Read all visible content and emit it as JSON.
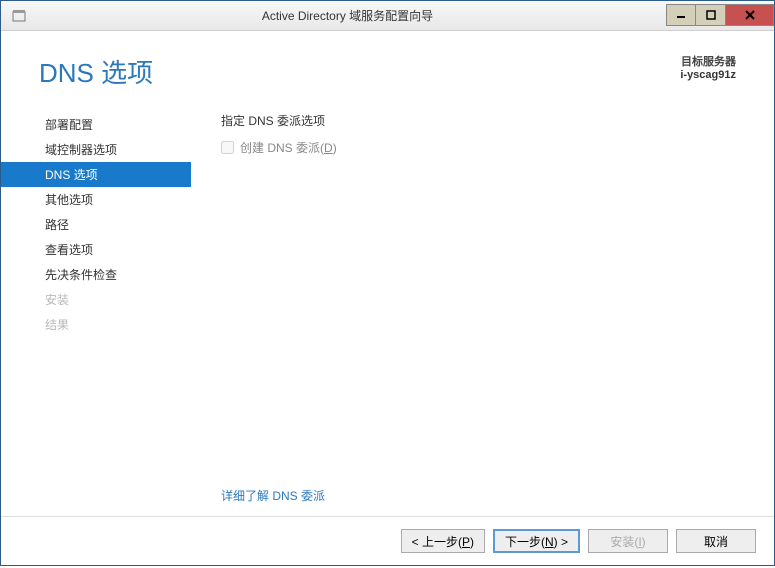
{
  "titlebar": {
    "title": "Active Directory 域服务配置向导"
  },
  "header": {
    "page_title": "DNS 选项",
    "target_label": "目标服务器",
    "target_name": "i-yscag91z"
  },
  "sidebar": {
    "items": [
      {
        "label": "部署配置",
        "state": "normal"
      },
      {
        "label": "域控制器选项",
        "state": "normal"
      },
      {
        "label": "DNS 选项",
        "state": "selected"
      },
      {
        "label": "其他选项",
        "state": "normal"
      },
      {
        "label": "路径",
        "state": "normal"
      },
      {
        "label": "查看选项",
        "state": "normal"
      },
      {
        "label": "先决条件检查",
        "state": "normal"
      },
      {
        "label": "安装",
        "state": "disabled"
      },
      {
        "label": "结果",
        "state": "disabled"
      }
    ]
  },
  "main": {
    "section_label": "指定 DNS 委派选项",
    "checkbox_label_pre": "创建 DNS 委派(",
    "checkbox_label_key": "D",
    "checkbox_label_post": ")",
    "more_link": "详细了解 DNS 委派"
  },
  "buttons": {
    "previous_pre": "< 上一步(",
    "previous_key": "P",
    "previous_post": ")",
    "next_pre": "下一步(",
    "next_key": "N",
    "next_post": ") >",
    "install_pre": "安装(",
    "install_key": "I",
    "install_post": ")",
    "cancel": "取消"
  }
}
